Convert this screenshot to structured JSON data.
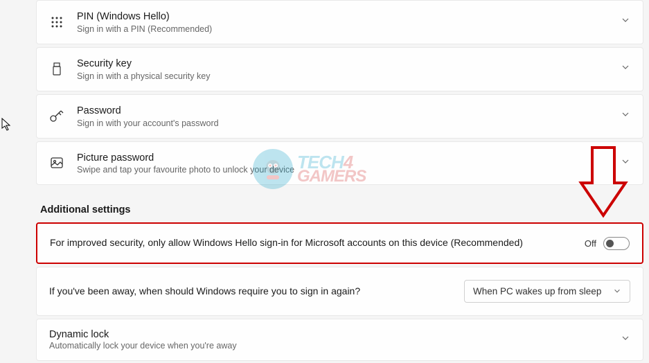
{
  "signin_options": [
    {
      "icon": "pin-grid-icon",
      "title": "PIN (Windows Hello)",
      "desc": "Sign in with a PIN (Recommended)"
    },
    {
      "icon": "security-key-icon",
      "title": "Security key",
      "desc": "Sign in with a physical security key"
    },
    {
      "icon": "password-key-icon",
      "title": "Password",
      "desc": "Sign in with your account's password"
    },
    {
      "icon": "picture-password-icon",
      "title": "Picture password",
      "desc": "Swipe and tap your favourite photo to unlock your device"
    }
  ],
  "section_header": "Additional settings",
  "settings": {
    "hello_only": {
      "text": "For improved security, only allow Windows Hello sign-in for Microsoft accounts on this device (Recommended)",
      "toggle_label": "Off",
      "toggle_state": false
    },
    "require_signin": {
      "text": "If you've been away, when should Windows require you to sign in again?",
      "dropdown_value": "When PC wakes up from sleep"
    },
    "dynamic_lock": {
      "title": "Dynamic lock",
      "desc": "Automatically lock your device when you're away"
    }
  },
  "watermark": {
    "line1a": "TECH",
    "line1b": "4",
    "line2": "GAMERS"
  }
}
